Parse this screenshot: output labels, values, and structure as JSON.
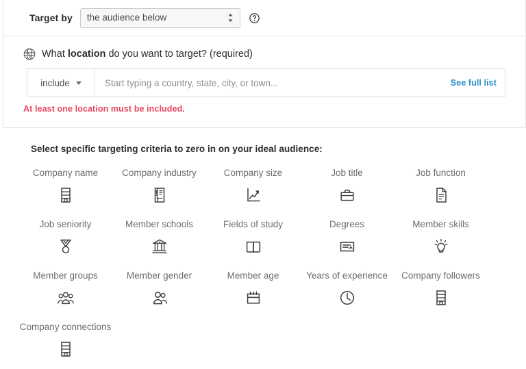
{
  "target_by": {
    "label": "Target by",
    "selected": "the audience below",
    "options": [
      "the audience below"
    ],
    "help_icon": "question-circle-icon",
    "spinner_icon": "up-down-arrows-icon"
  },
  "location": {
    "icon": "globe-icon",
    "heading_prefix": "What ",
    "heading_bold": "location",
    "heading_suffix": " do you want to target? (required)",
    "include_label": "include",
    "include_caret_icon": "chevron-down-icon",
    "input_value": "",
    "input_placeholder": "Start typing a country, state, city, or town...",
    "see_full_list": "See full list",
    "error": "At least one location must be included."
  },
  "criteria": {
    "heading": "Select specific targeting criteria to zero in on your ideal audience:",
    "items": [
      {
        "label": "Company name",
        "icon": "building-icon"
      },
      {
        "label": "Company industry",
        "icon": "industry-list-icon"
      },
      {
        "label": "Company size",
        "icon": "growth-chart-icon"
      },
      {
        "label": "Job title",
        "icon": "briefcase-icon"
      },
      {
        "label": "Job function",
        "icon": "document-icon"
      },
      {
        "label": "Job seniority",
        "icon": "medal-icon"
      },
      {
        "label": "Member schools",
        "icon": "bank-building-icon"
      },
      {
        "label": "Fields of study",
        "icon": "open-book-icon"
      },
      {
        "label": "Degrees",
        "icon": "certificate-icon"
      },
      {
        "label": "Member skills",
        "icon": "lightbulb-icon"
      },
      {
        "label": "Member groups",
        "icon": "people-group-icon"
      },
      {
        "label": "Member gender",
        "icon": "two-people-icon"
      },
      {
        "label": "Member age",
        "icon": "calendar-icon"
      },
      {
        "label": "Years of experience",
        "icon": "clock-icon"
      },
      {
        "label": "Company followers",
        "icon": "building-icon"
      },
      {
        "label": "Company connections",
        "icon": "building-icon"
      }
    ]
  },
  "colors": {
    "link": "#2d8ecf",
    "error": "#e8455f",
    "text": "#3b3b3b",
    "muted": "#6d6d6d",
    "divider": "#e4e4e4"
  }
}
